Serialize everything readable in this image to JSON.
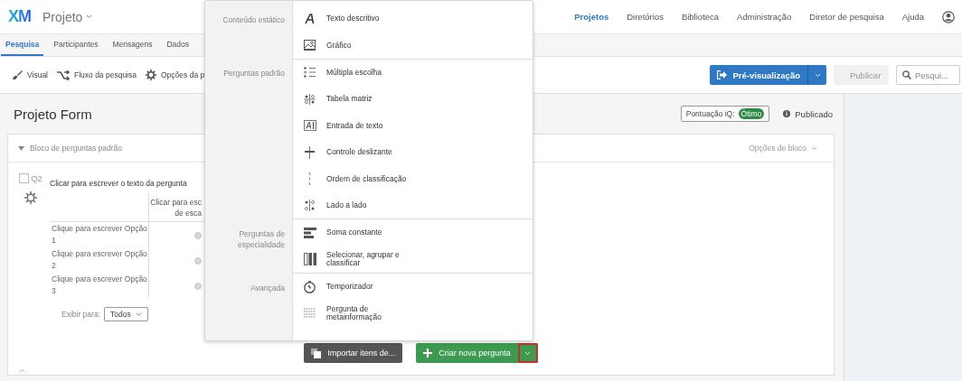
{
  "app": {
    "logo": "XM",
    "product": "Projeto"
  },
  "nav": [
    {
      "label": "Projetos",
      "selected": true
    },
    {
      "label": "Diretórios",
      "selected": false
    },
    {
      "label": "Biblioteca",
      "selected": false
    },
    {
      "label": "Administração",
      "selected": false
    },
    {
      "label": "Diretor de pesquisa",
      "selected": false
    },
    {
      "label": "Ajuda",
      "selected": false
    }
  ],
  "tabs": [
    {
      "label": "Pesquisa",
      "selected": true
    },
    {
      "label": "Participantes",
      "selected": false
    },
    {
      "label": "Mensagens",
      "selected": false
    },
    {
      "label": "Dados",
      "selected": false
    }
  ],
  "toolbar": {
    "tools": [
      {
        "label": "Visual",
        "kind": "brush"
      },
      {
        "label": "Fluxo da pesquisa",
        "kind": "flow"
      },
      {
        "label": "Opções da p",
        "kind": "gear"
      }
    ],
    "preview_button": "Pré-visualização",
    "publish_button": {
      "label": "Publicar",
      "disabled": true
    },
    "search": {
      "placeholder": "Pesqui..."
    }
  },
  "project": {
    "title": "Projeto Form",
    "iq_label": "Pontuação iQ:",
    "iq_badge": "Ótimo",
    "status": "Publicado"
  },
  "block": {
    "title": "Bloco de perguntas padrão",
    "expanded": true,
    "options": "Opções de bloco",
    "question": {
      "number": "Q2",
      "checked": false,
      "text": "Clicar para escrever o texto da pergunta",
      "column_header": [
        "Clicar para esc",
        "de esca"
      ],
      "rows": [
        {
          "label": "Clique para escrever Opção 1",
          "selected": false
        },
        {
          "label": "Clique para escrever Opção 2",
          "selected": false
        },
        {
          "label": "Clique para escrever Opção 3",
          "selected": false
        }
      ],
      "display_label": "Exibir para:",
      "display_value": "Todos"
    },
    "import_button": "Importar itens de...",
    "create_button": {
      "label": "Criar nova pergunta",
      "menu_highlighted": true
    }
  },
  "menu": {
    "sections": [
      {
        "title": "Conteúdo estático",
        "items": [
          {
            "label": "Texto descritivo",
            "kind": "text"
          },
          {
            "label": "Gráfico",
            "kind": "graphic"
          }
        ]
      },
      {
        "title": "Perguntas padrão",
        "items": [
          {
            "label": "Múltipla escolha",
            "kind": "choice"
          },
          {
            "label": "Tabela matriz",
            "kind": "matrix"
          },
          {
            "label": "Entrada de texto",
            "kind": "entry"
          },
          {
            "label": "Controle deslizante",
            "kind": "slider"
          },
          {
            "label": "Ordem de classificação",
            "kind": "rank"
          },
          {
            "label": "Lado a lado",
            "kind": "sbs"
          }
        ]
      },
      {
        "title": "Perguntas de especialidade",
        "items": [
          {
            "label": "Soma constante",
            "kind": "sum"
          },
          {
            "label": "Selecionar, agrupar e classificar",
            "kind": "group"
          }
        ]
      },
      {
        "title": "Avançada",
        "items": [
          {
            "label": "Temporizador",
            "kind": "timer"
          },
          {
            "label": "Pergunta de metainformação",
            "kind": "meta"
          }
        ]
      }
    ]
  }
}
